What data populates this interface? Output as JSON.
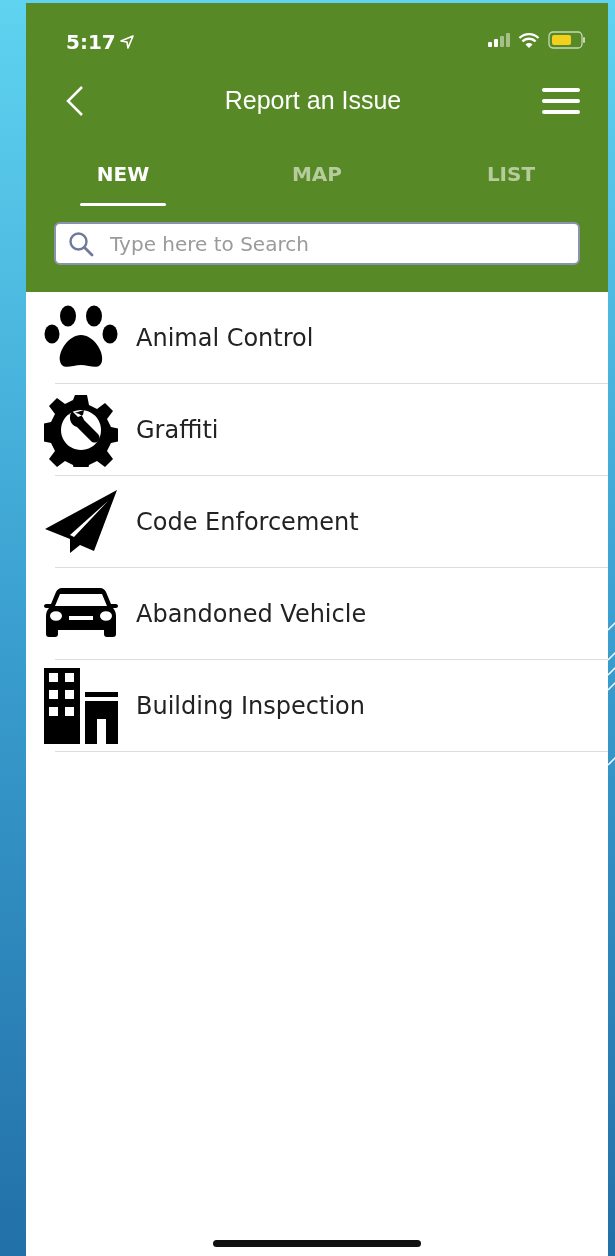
{
  "status_bar": {
    "time": "5:17"
  },
  "header": {
    "title": "Report an Issue"
  },
  "tabs": [
    {
      "label": "NEW",
      "selected": true
    },
    {
      "label": "MAP",
      "selected": false
    },
    {
      "label": "LIST",
      "selected": false
    }
  ],
  "search": {
    "placeholder": "Type here to Search"
  },
  "items": [
    {
      "kind": "paw",
      "label": "Animal Control"
    },
    {
      "kind": "gear",
      "label": "Graffiti"
    },
    {
      "kind": "plane",
      "label": "Code Enforcement"
    },
    {
      "kind": "car",
      "label": "Abandoned Vehicle"
    },
    {
      "kind": "building",
      "label": "Building Inspection"
    }
  ]
}
